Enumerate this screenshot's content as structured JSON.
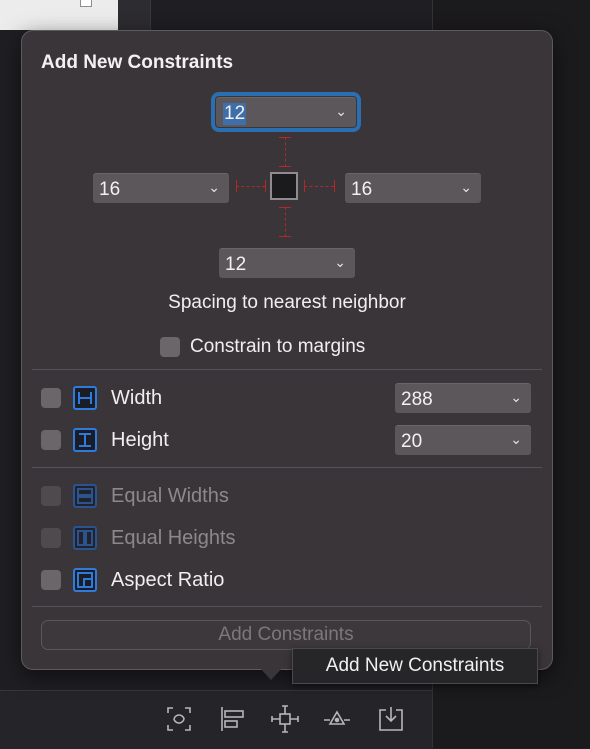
{
  "popover": {
    "title": "Add New Constraints",
    "spacing": {
      "top": "12",
      "left": "16",
      "right": "16",
      "bottom": "12"
    },
    "caption": "Spacing to nearest neighbor",
    "constrain_to_margins": {
      "label": "Constrain to margins",
      "checked": false
    },
    "width": {
      "label": "Width",
      "value": "288",
      "checked": false
    },
    "height": {
      "label": "Height",
      "value": "20",
      "checked": false
    },
    "equal_widths": {
      "label": "Equal Widths",
      "enabled": false
    },
    "equal_heights": {
      "label": "Equal Heights",
      "enabled": false
    },
    "aspect_ratio": {
      "label": "Aspect Ratio",
      "checked": false
    },
    "add_button": "Add Constraints"
  },
  "tooltip": "Add New Constraints",
  "toolbar": {
    "icons": [
      "update-frames-icon",
      "align-icon",
      "add-constraints-icon",
      "resolve-issues-icon",
      "embed-in-icon"
    ]
  },
  "colors": {
    "accent": "#2f7bdc",
    "pin": "#b42828",
    "popover_bg": "#3a3539"
  }
}
